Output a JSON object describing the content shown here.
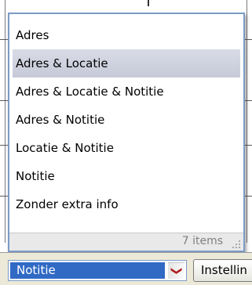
{
  "dropdown": {
    "items": [
      {
        "label": "Adres"
      },
      {
        "label": "Adres & Locatie"
      },
      {
        "label": "Adres & Locatie & Notitie"
      },
      {
        "label": "Adres & Notitie"
      },
      {
        "label": "Locatie & Notitie"
      },
      {
        "label": "Notitie"
      },
      {
        "label": "Zonder extra info"
      }
    ],
    "highlighted_item": "Adres & Locatie",
    "status_text": "7 items"
  },
  "combo": {
    "selected_value": "Notitie",
    "arrow_icon": "chevron-down-icon"
  },
  "toolbar": {
    "settings_label": "Instellin"
  },
  "colors": {
    "selection": "#316ac5",
    "highlight": "#c6c9d8",
    "dropdown_border": "#7c9bc6",
    "arrow": "#b01c1c"
  }
}
